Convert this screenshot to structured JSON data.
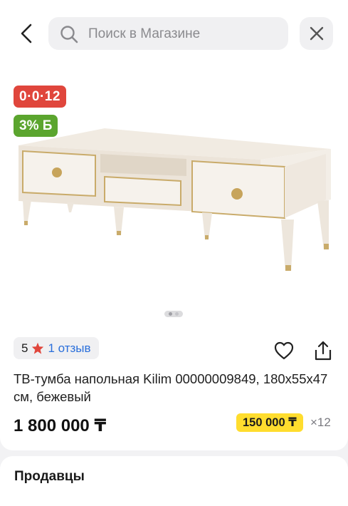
{
  "search": {
    "placeholder": "Поиск в Магазине"
  },
  "product": {
    "badge_installment": "0·0·12",
    "badge_bonus": "3% Б",
    "rating_value": "5",
    "reviews_label": "1 отзыв",
    "title": "ТВ-тумба напольная Kilim 00000009849, 180x55x47 см, бежевый",
    "price": "1 800 000 ₸",
    "installment_price": "150 000 ₸",
    "installment_months": "×12"
  },
  "sellers": {
    "title": "Продавцы"
  },
  "colors": {
    "accent_red": "#e0463c",
    "bonus_green": "#5ba52e",
    "link_blue": "#2a6fdb",
    "installment_yellow": "#ffdd2e"
  },
  "icons": [
    "back-arrow-icon",
    "search-icon",
    "close-icon",
    "star-icon",
    "heart-icon",
    "share-icon"
  ]
}
